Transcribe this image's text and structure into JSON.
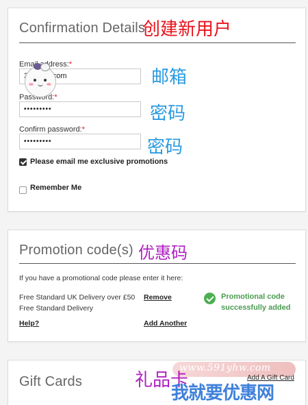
{
  "confirmation": {
    "title": "Confirmation Details",
    "annotation": "创建新用户",
    "email_label": "Email address:",
    "email_value": "3        4@qq.com",
    "email_annotation": "邮箱",
    "password_label": "Password:",
    "password_value": "•••••••••",
    "password_annotation": "密码",
    "confirm_label": "Confirm password:",
    "confirm_value": "•••••••••",
    "confirm_annotation": "密码",
    "required_mark": "*",
    "promotions_label": "Please email me exclusive promotions",
    "promotions_checked": true,
    "remember_label": "Remember Me",
    "remember_checked": false
  },
  "promotion": {
    "title": "Promotion code(s)",
    "annotation": "优惠码",
    "intro": "If you have a promotional code please enter it here:",
    "code_line_1": "Free Standard UK Delivery over £50",
    "code_line_2": "Free Standard Delivery",
    "remove_label": "Remove",
    "success_line_1": "Promotional code",
    "success_line_2": "successfully added",
    "help_label": "Help?",
    "add_another_label": "Add Another"
  },
  "gift": {
    "title": "Gift Cards",
    "annotation": "礼品卡",
    "add_label": "Add A Gift Card"
  },
  "watermark": {
    "url": "www.591yhw.com",
    "text": "我就要优惠网"
  },
  "colors": {
    "accent_red": "#e8131b",
    "annotation_blue": "#2b9ae0",
    "annotation_purple": "#b01ec0",
    "success_green": "#4caf50"
  }
}
